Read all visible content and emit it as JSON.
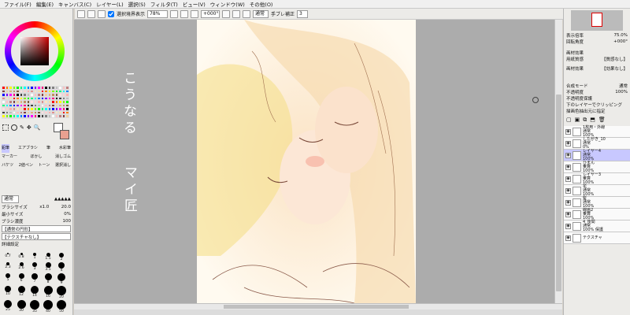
{
  "menu": [
    "ファイル(F)",
    "編集(E)",
    "キャンバス(C)",
    "レイヤー(L)",
    "選択(S)",
    "フィルタ(T)",
    "ビュー(V)",
    "ウィンドウ(W)",
    "その他(O)"
  ],
  "toolbar": {
    "selection_display": "選択境界表示",
    "zoom": "78%",
    "rotation": "+000°",
    "blend_mode": "通常",
    "stabilizer_label": "手ブレ補正",
    "stabilizer_value": "3"
  },
  "navigator": {
    "zoom_label": "表示倍率",
    "zoom_value": "75.0%",
    "angle_label": "回転角度",
    "angle_value": "+000°"
  },
  "paper_texture": {
    "header": "画材効果",
    "texture_label": "用紙質感",
    "texture_value": "【質感なし】",
    "effect_label": "画材効果",
    "effect_value": "【効果なし】"
  },
  "layer_props": {
    "blend_label": "合成モード",
    "blend_value": "通常",
    "opacity_label": "不透明度",
    "opacity_value": "100%",
    "protect": "不透明度保護",
    "clip": "下のレイヤーでクリッピング",
    "specify": "描画色抽出元に指定"
  },
  "layers": [
    {
      "name": "1枚用・外線",
      "mode": "通常",
      "opacity": "100%"
    },
    {
      "name": "したがき_10",
      "mode": "通常",
      "opacity": "0%"
    },
    {
      "name": "レイヤー4",
      "mode": "通常",
      "opacity": "100%"
    },
    {
      "name": "ひまん",
      "mode": "乗算",
      "opacity": "100%"
    },
    {
      "name": "レイヤー3",
      "mode": "乗算",
      "opacity": "100%"
    },
    {
      "name": "花",
      "mode": "通常",
      "opacity": "100%"
    },
    {
      "name": "髪",
      "mode": "通常",
      "opacity": "100%"
    },
    {
      "name": "線画2",
      "mode": "乗算",
      "opacity": "100%"
    },
    {
      "name": "4_後間",
      "mode": "通常",
      "opacity": "100% 保護"
    },
    {
      "name": "テクスチャ",
      "mode": "",
      "opacity": ""
    }
  ],
  "tools": {
    "row1": [
      "鉛筆",
      "エアブラシ",
      "筆",
      "水彩筆"
    ],
    "row2": [
      "マーカー",
      "ぼかし",
      "消しゴム"
    ],
    "row3": [
      "バケツ",
      "2値ペン",
      "トーン",
      "選択消し"
    ]
  },
  "brush": {
    "blend": "通常",
    "size_label": "ブラシサイズ",
    "size_mult": "x1.0",
    "size_value": "20.0",
    "min_label": "最小サイズ",
    "min_value": "0%",
    "density_label": "ブラシ濃度",
    "density_value": "100",
    "shape": "【通常の円形】",
    "texture": "【テクスチャなし】",
    "detail": "詳細設定"
  },
  "brush_sizes": [
    [
      "0.7",
      "0.8",
      "1",
      "1.5",
      "2"
    ],
    [
      "2.3",
      "2.6",
      "3",
      "3.5",
      "4"
    ],
    [
      "5",
      "6",
      "7",
      "8",
      "9"
    ],
    [
      "10",
      "12",
      "14",
      "16",
      "20"
    ],
    [
      "25",
      "30",
      "35",
      "40",
      "50"
    ]
  ],
  "canvas_text": {
    "line1": "こうなる",
    "line2": "マイ匠"
  },
  "status": "",
  "colors": {
    "accent": "#c8c8ff",
    "sel_border": "#5050c8"
  }
}
